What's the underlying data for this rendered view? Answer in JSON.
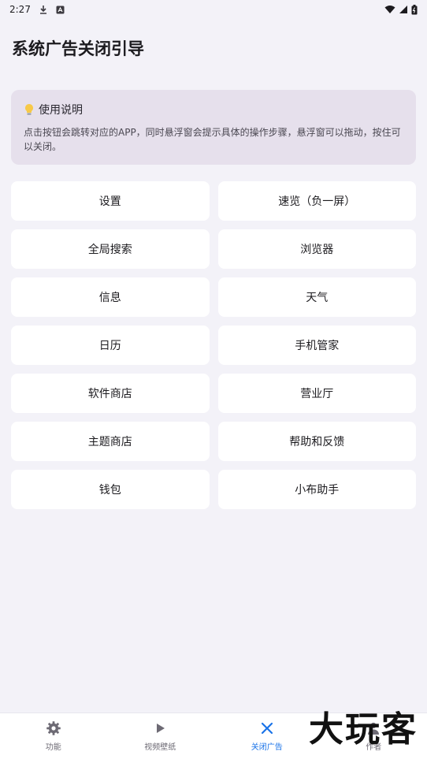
{
  "status_bar": {
    "time": "2:27"
  },
  "page": {
    "title": "系统广告关闭引导"
  },
  "info_card": {
    "heading": "使用说明",
    "body": "点击按钮会跳转对应的APP，同时悬浮窗会提示具体的操作步骤，悬浮窗可以拖动，按住可以关闭。"
  },
  "buttons": [
    "设置",
    "速览（负一屏）",
    "全局搜索",
    "浏览器",
    "信息",
    "天气",
    "日历",
    "手机管家",
    "软件商店",
    "营业厅",
    "主题商店",
    "帮助和反馈",
    "钱包",
    "小布助手"
  ],
  "bottom_nav": [
    {
      "label": "功能",
      "icon": "gear-icon"
    },
    {
      "label": "视频壁纸",
      "icon": "play-icon"
    },
    {
      "label": "关闭广告",
      "icon": "close-icon"
    },
    {
      "label": "作者",
      "icon": "person-icon"
    }
  ],
  "watermark": "大玩客",
  "colors": {
    "accent": "#1a73e8",
    "card_bg": "#e6e0ec",
    "page_bg": "#f3f2f8"
  }
}
